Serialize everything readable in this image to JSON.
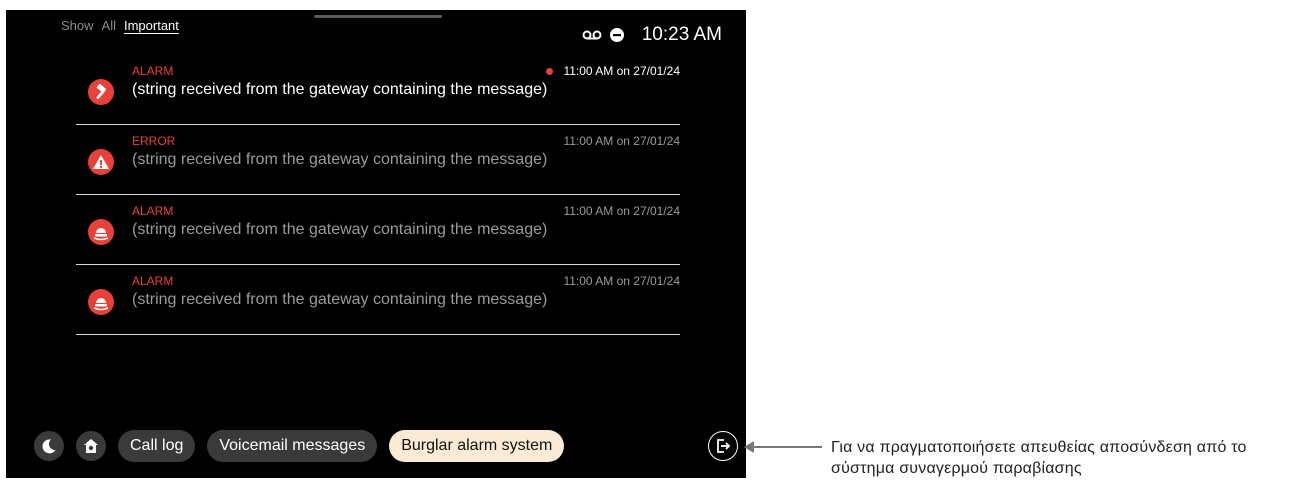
{
  "filters": {
    "show_label": "Show",
    "all_label": "All",
    "important_label": "Important"
  },
  "status": {
    "voicemail_icon": "voicemail-icon",
    "dnd_icon": "do-not-disturb-icon",
    "time": "10:23 AM"
  },
  "notifications": [
    {
      "category": "ALARM",
      "timestamp": "11:00 AM on 27/01/24",
      "message": "(string received from the gateway containing the message)",
      "icon": "hammer-icon",
      "unread": true
    },
    {
      "category": "ERROR",
      "timestamp": "11:00 AM on 27/01/24",
      "message": "(string received from the gateway containing the message)",
      "icon": "warning-icon",
      "unread": false
    },
    {
      "category": "ALARM",
      "timestamp": "11:00 AM on 27/01/24",
      "message": "(string received from the gateway containing the message)",
      "icon": "siren-icon",
      "unread": false
    },
    {
      "category": "ALARM",
      "timestamp": "11:00 AM on 27/01/24",
      "message": "(string received from the gateway containing the message)",
      "icon": "siren-icon",
      "unread": false
    }
  ],
  "bottombar": {
    "night_icon": "moon-icon",
    "home_icon": "home-settings-icon",
    "chips": [
      "Call log",
      "Voicemail messages",
      "Burglar alarm system"
    ],
    "active_chip": "Burglar alarm system",
    "logout_icon": "logout-icon"
  },
  "caption": "Για να πραγματοποιήσετε απευθείας αποσύνδεση από το σύστημα συναγερμού παραβίασης",
  "colors": {
    "accent_red": "#e8413a",
    "active_chip": "#fbebd4",
    "screen_bg": "#000000"
  }
}
